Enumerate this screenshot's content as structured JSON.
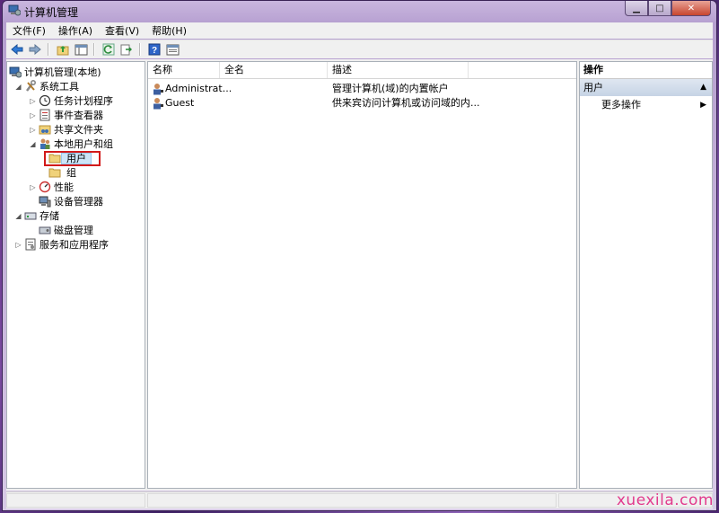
{
  "window": {
    "title": "计算机管理",
    "controls": [
      "minimize",
      "maximize",
      "close"
    ]
  },
  "menu": {
    "items": [
      "文件(F)",
      "操作(A)",
      "查看(V)",
      "帮助(H)"
    ]
  },
  "toolbar": {
    "icons": [
      "back-icon",
      "forward-icon",
      "up-folder-icon",
      "show-hide-tree-icon",
      "refresh-icon",
      "export-icon",
      "help-icon",
      "properties-icon"
    ]
  },
  "tree": {
    "root": "计算机管理(本地)",
    "system_tools": "系统工具",
    "task_scheduler": "任务计划程序",
    "event_viewer": "事件查看器",
    "shared_folders": "共享文件夹",
    "local_users": "本地用户和组",
    "users": "用户",
    "groups": "组",
    "performance": "性能",
    "device_manager": "设备管理器",
    "storage": "存储",
    "disk_management": "磁盘管理",
    "services_apps": "服务和应用程序"
  },
  "list": {
    "columns": {
      "name": "名称",
      "full_name": "全名",
      "description": "描述"
    },
    "rows": [
      {
        "name": "Administrat...",
        "full_name": "",
        "description": "管理计算机(域)的内置帐户"
      },
      {
        "name": "Guest",
        "full_name": "",
        "description": "供来宾访问计算机或访问域的内..."
      }
    ]
  },
  "actions": {
    "header": "操作",
    "section": "用户",
    "more": "更多操作"
  },
  "watermark": "xuexila.com",
  "colors": {
    "highlight_box": "#d21a1a",
    "selection": "#cde5f7",
    "watermark": "#e23b8d"
  }
}
